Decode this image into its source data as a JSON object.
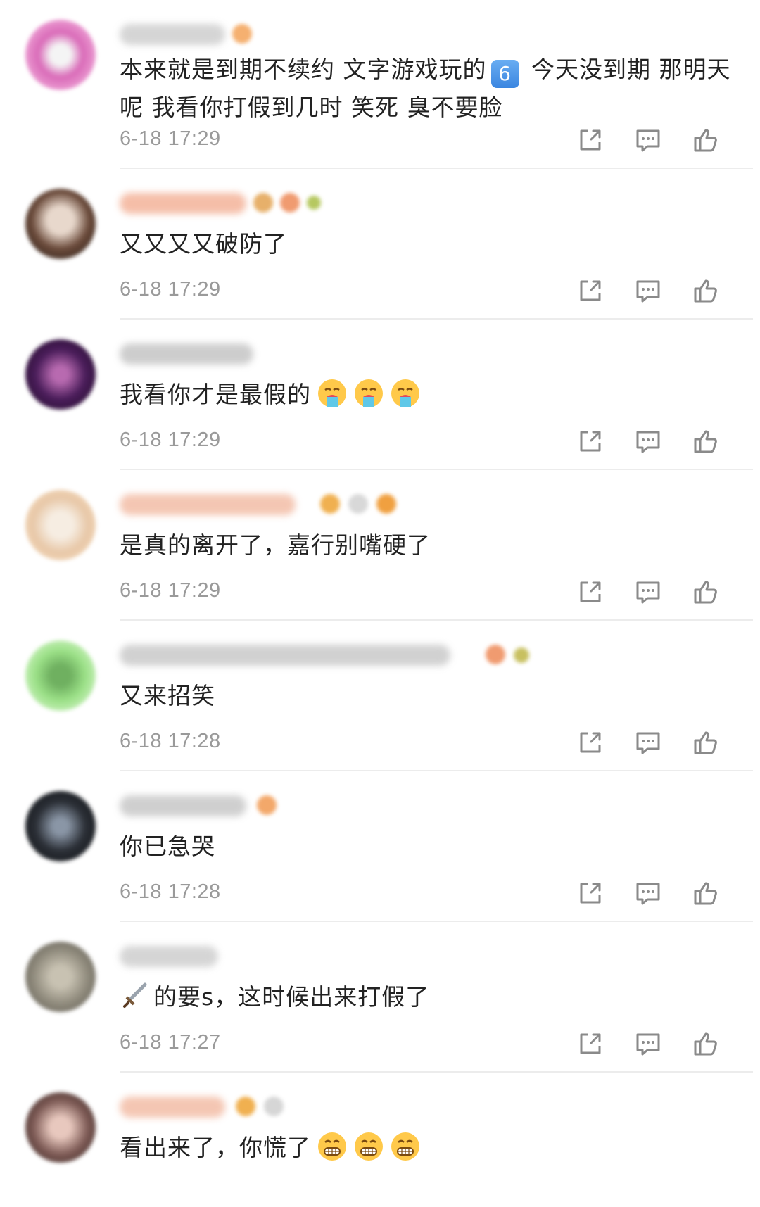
{
  "comments": [
    {
      "text": "本来就是到期不续约 文字游戏玩的",
      "badge": "6",
      "text2": " 今天没到期 那明天呢 我看你打假到几时 笑死 臭不要脸",
      "time": "6-18 17:29",
      "avatar_color": "#d96ab8",
      "name_color": "#bfbfbf",
      "name_width": 150,
      "emojis": 1
    },
    {
      "text": "又又又又破防了",
      "time": "6-18 17:29",
      "avatar_color": "#6a4a3a",
      "name_color": "#f2a98c",
      "name_width": 180,
      "emojis": 3
    },
    {
      "text": "我看你才是最假的",
      "time": "6-18 17:29",
      "avatar_color": "#4a1d5a",
      "name_color": "#b9b9b9",
      "name_width": 190,
      "emojis": 0,
      "face": "vomit",
      "face_count": 3
    },
    {
      "text": "是真的离开了，嘉行别嘴硬了",
      "time": "6-18 17:29",
      "avatar_color": "#e8c8a8",
      "name_color": "#f1b49a",
      "name_width": 250,
      "emojis": 3
    },
    {
      "text": "又来招笑",
      "time": "6-18 17:28",
      "avatar_color": "#9be087",
      "name_color": "#c2c2c2",
      "name_width": 470,
      "emojis": 2
    },
    {
      "text": "你已急哭",
      "time": "6-18 17:28",
      "avatar_color": "#2b2f36",
      "name_color": "#c0c0c0",
      "name_width": 180,
      "emojis": 1
    },
    {
      "text": "的要s，这时候出来打假了",
      "prefix": "sword",
      "time": "6-18 17:27",
      "avatar_color": "#8f8a7c",
      "name_color": "#c8c8c8",
      "name_width": 140,
      "emojis": 0
    },
    {
      "text": "看出来了，你慌了",
      "time": "",
      "avatar_color": "#7d5a55",
      "name_color": "#f1b49a",
      "name_width": 150,
      "emojis": 2,
      "face": "grin",
      "face_count": 3
    }
  ],
  "icons": {
    "share": "share-icon",
    "comment": "comment-icon",
    "like": "like-icon"
  }
}
